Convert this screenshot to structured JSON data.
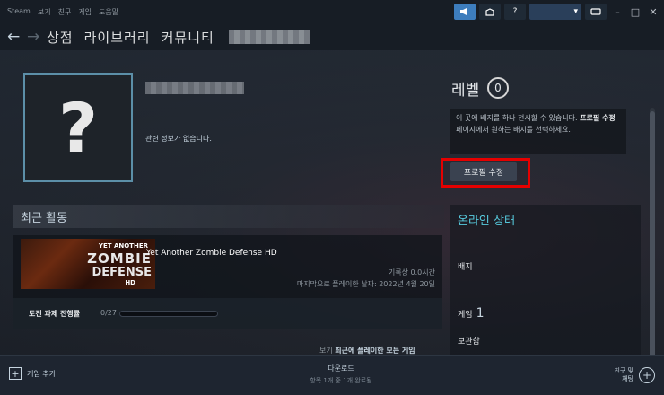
{
  "titlebar": {
    "menu": [
      "Steam",
      "보기",
      "친구",
      "게임",
      "도움말"
    ],
    "help_label": "?",
    "account_caret": "▾",
    "window_controls": {
      "minimize": "–",
      "maximize": "□",
      "close": "✕"
    }
  },
  "navbar": {
    "back": "←",
    "forward": "→",
    "links": [
      "상점",
      "라이브러리",
      "커뮤니티"
    ]
  },
  "profile": {
    "avatar_glyph": "?",
    "info": "관련 정보가 없습니다.",
    "level_label": "레벨",
    "level_value": "0",
    "badge_hint_pre": "이 곳에 배지를 하나 전시할 수 있습니다. ",
    "badge_hint_link": "프로필 수정",
    "badge_hint_post": " 페이지에서 원하는 배지를 선택하세요.",
    "edit_button": "프로필 수정"
  },
  "recent": {
    "title": "최근 활동",
    "game": {
      "caption_line1": "YET ANOTHER",
      "caption_line2": "ZOMBIE",
      "caption_line3": "DEFENSE",
      "caption_line4": "HD",
      "name": "Yet Another Zombie Defense HD",
      "record": "기록상 0.0시간",
      "last_played": "마지막으로 플레이한 날짜: 2022년 4월 20일"
    },
    "achievements": {
      "label": "도전 과제 진행률",
      "count": "0/27",
      "progress": 0
    },
    "view_prefix": "보기",
    "view_link": "최근에 플레이한 모든 게임"
  },
  "sidebar": {
    "online_status": "온라인 상태",
    "badges": "배지",
    "games": "게임",
    "games_count": "1",
    "inventory": "보관함"
  },
  "bottombar": {
    "add_game": "게임 추가",
    "download_title": "다운로드",
    "download_status": "항목 1개 중 1개 완료됨",
    "friends_line1": "친구 및",
    "friends_line2": "채팅"
  },
  "colors": {
    "accent": "#57cbde",
    "highlight": "#e60000",
    "background": "#1b2028"
  }
}
